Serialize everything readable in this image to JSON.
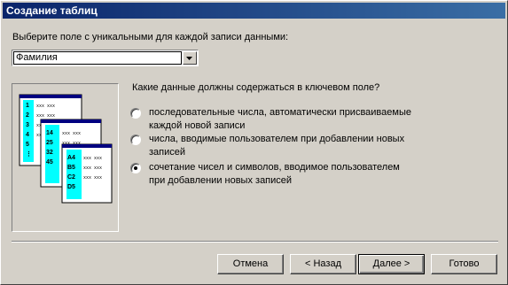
{
  "window": {
    "title": "Создание таблиц"
  },
  "field_prompt": "Выберите поле с уникальными для каждой записи данными:",
  "field_select": {
    "value": "Фамилия"
  },
  "question": "Какие данные должны содержаться в ключевом поле?",
  "options": [
    {
      "label": "последовательные числа, автоматически присваиваемые каждой новой записи",
      "checked": false
    },
    {
      "label": "числа, вводимые пользователем при добавлении новых записей",
      "checked": false
    },
    {
      "label": "сочетание чисел и символов, вводимое пользователем при добавлении новых записей",
      "checked": true
    }
  ],
  "illustration": {
    "sheet1_keys": [
      "1",
      "2",
      "3",
      "4",
      "5",
      "⋮"
    ],
    "sheet2_keys": [
      "14",
      "25",
      "32",
      "45"
    ],
    "sheet3_keys": [
      "A4",
      "B5",
      "C2",
      "D5"
    ],
    "cell_text": "xxx xxx"
  },
  "buttons": {
    "cancel": "Отмена",
    "back": "< Назад",
    "next": "Далее >",
    "finish": "Готово"
  },
  "colors": {
    "title_start": "#0a246a",
    "title_end": "#3a6ea5",
    "key_column": "#00ffff",
    "sheet_header": "#000080"
  }
}
